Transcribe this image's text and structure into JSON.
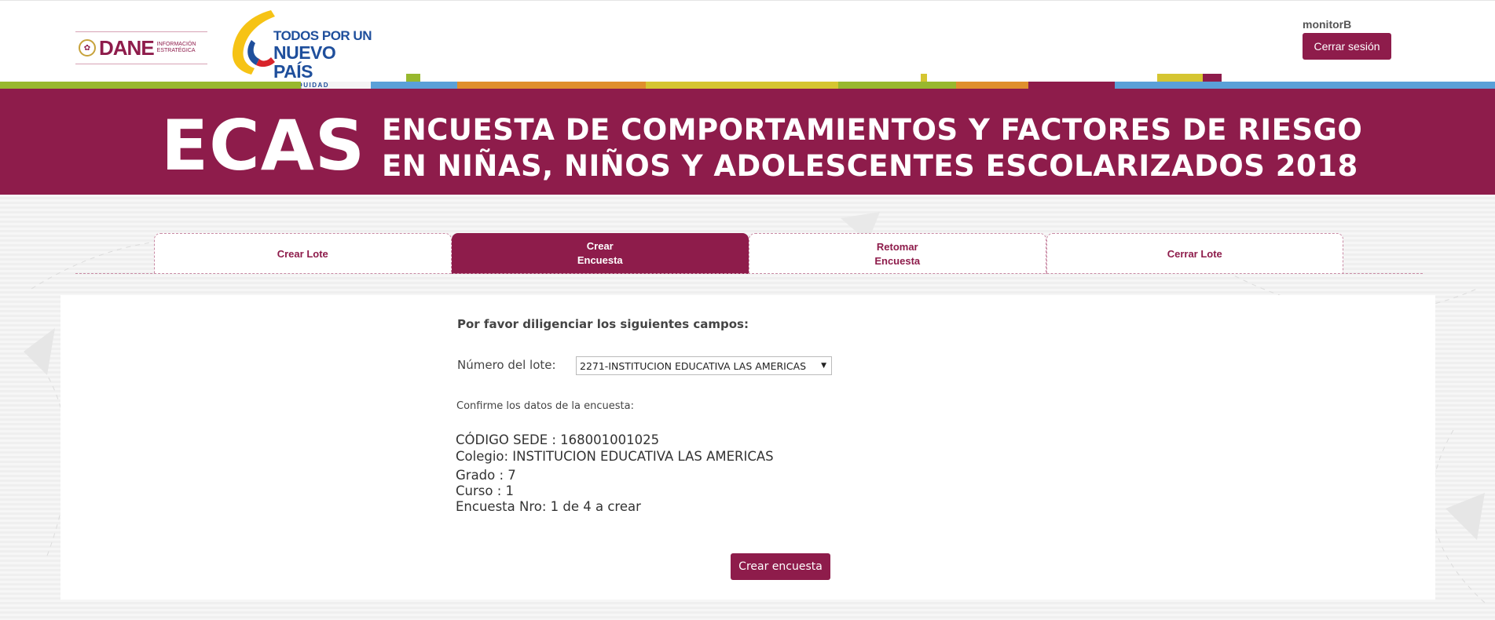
{
  "header": {
    "dane_logo": {
      "word": "DANE",
      "sub": "INFORMACIÓN ESTRATÉGICA"
    },
    "gov_logo": {
      "line1": "TODOS POR UN",
      "line2": "NUEVO PAÍS",
      "line3": "PAZ  EQUIDAD  EDUCACIÓN"
    },
    "username": "monitorB",
    "logout_label": "Cerrar sesión"
  },
  "banner": {
    "acronym": "ECAS",
    "title": "ENCUESTA DE COMPORTAMIENTOS Y FACTORES DE RIESGO EN NIÑAS, NIÑOS Y ADOLESCENTES ESCOLARIZADOS 2018"
  },
  "tabs": [
    {
      "label": "Crear Lote",
      "active": false
    },
    {
      "label": "Crear\nEncuesta",
      "active": true
    },
    {
      "label": "Retomar\nEncuesta",
      "active": false
    },
    {
      "label": "Cerrar Lote",
      "active": false
    }
  ],
  "form": {
    "heading": "Por favor diligenciar los siguientes campos:",
    "lote_label": "Número del lote:",
    "lote_selected": "2271-INSTITUCION EDUCATIVA LAS AMERICAS",
    "confirm_label": "Confirme los datos de la encuesta:",
    "codigo_sede": "CÓDIGO SEDE : 168001001025",
    "colegio": "Colegio: INSTITUCION EDUCATIVA LAS AMERICAS",
    "grado": "Grado : 7",
    "curso": "Curso : 1",
    "encuesta_nro": "Encuesta Nro: 1 de 4 a crear",
    "submit_label": "Crear encuesta"
  },
  "colors": {
    "brand": "#8e1c4b",
    "gov_blue": "#1f4f9c"
  }
}
